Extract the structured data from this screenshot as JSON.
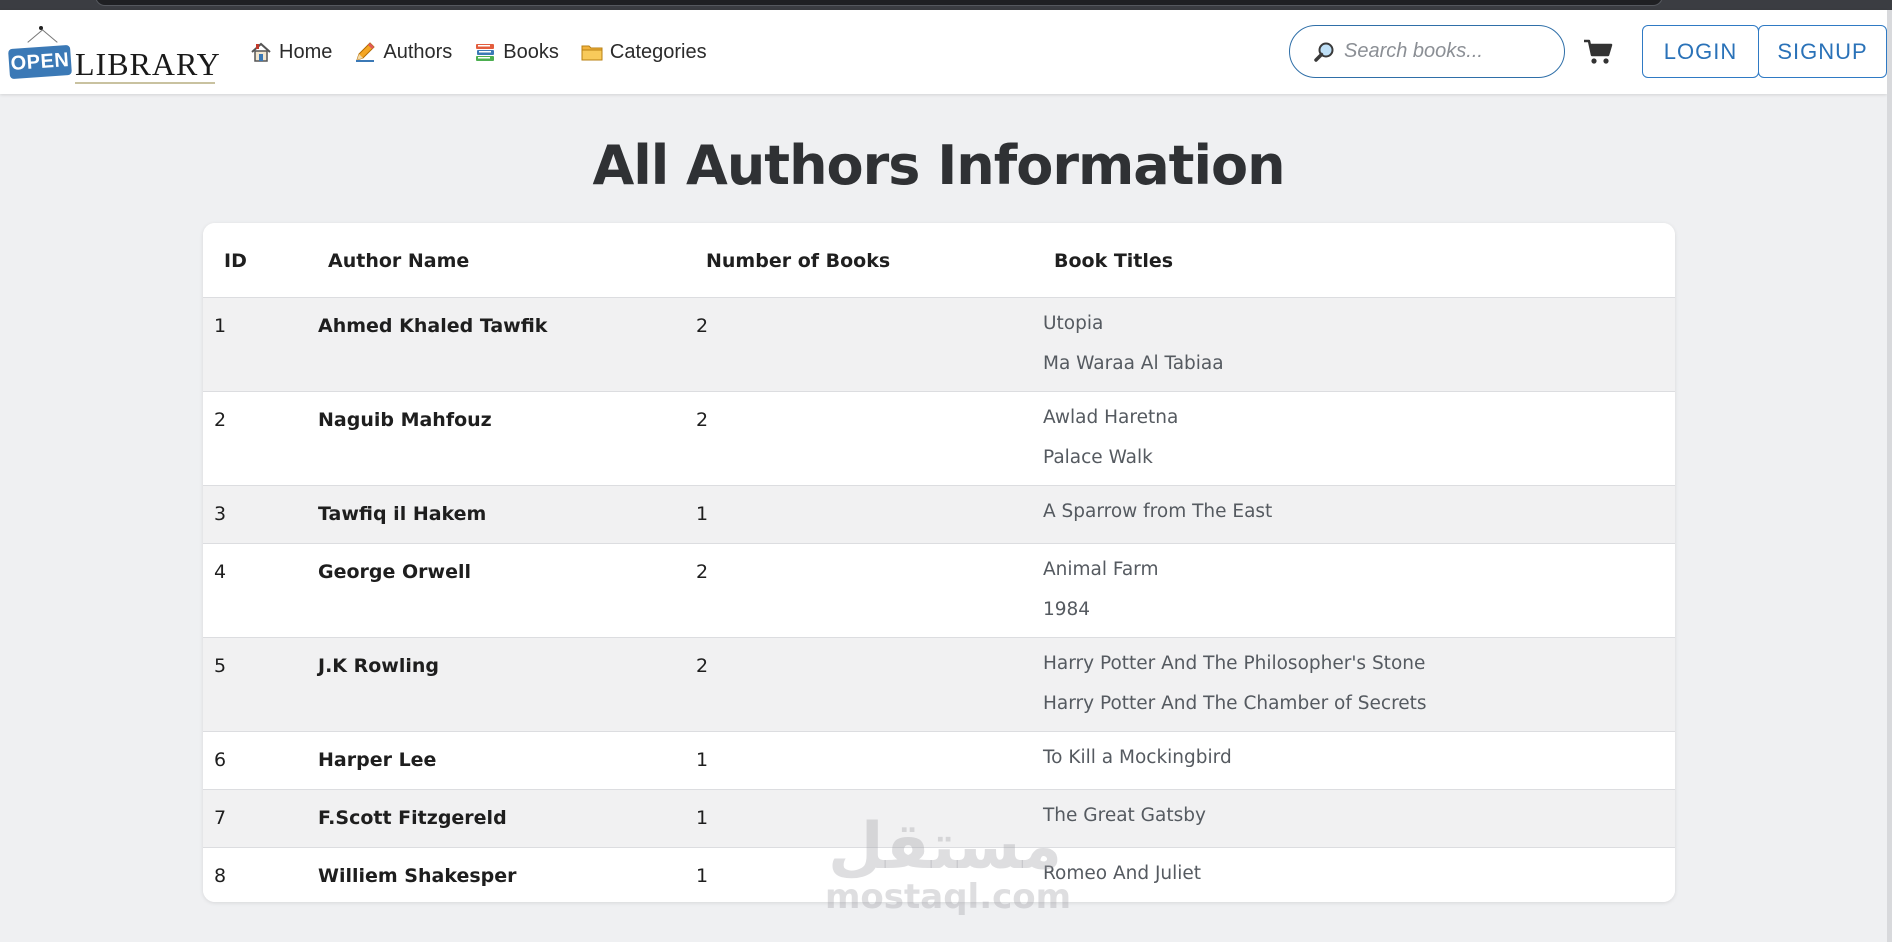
{
  "header": {
    "logo_open": "OPEN",
    "logo_library": "LIBRARY",
    "nav": [
      {
        "label": "Home",
        "icon": "home-icon"
      },
      {
        "label": "Authors",
        "icon": "pencil-icon"
      },
      {
        "label": "Books",
        "icon": "books-icon"
      },
      {
        "label": "Categories",
        "icon": "folder-icon"
      }
    ],
    "search_placeholder": "Search books...",
    "login_label": "LOGIN",
    "signup_label": "SIGNUP"
  },
  "page_title": "All Authors Information",
  "table": {
    "headers": [
      "ID",
      "Author Name",
      "Number of Books",
      "Book Titles"
    ],
    "rows": [
      {
        "id": "1",
        "name": "Ahmed Khaled Tawfik",
        "count": "2",
        "titles": [
          "Utopia",
          "Ma Waraa Al Tabiaa"
        ]
      },
      {
        "id": "2",
        "name": "Naguib Mahfouz",
        "count": "2",
        "titles": [
          "Awlad Haretna",
          "Palace Walk"
        ]
      },
      {
        "id": "3",
        "name": "Tawfiq il Hakem",
        "count": "1",
        "titles": [
          "A Sparrow from The East"
        ]
      },
      {
        "id": "4",
        "name": "George Orwell",
        "count": "2",
        "titles": [
          "Animal Farm",
          "1984"
        ]
      },
      {
        "id": "5",
        "name": "J.K Rowling",
        "count": "2",
        "titles": [
          "Harry Potter And The Philosopher's Stone",
          "Harry Potter And The Chamber of Secrets"
        ]
      },
      {
        "id": "6",
        "name": "Harper Lee",
        "count": "1",
        "titles": [
          "To Kill a Mockingbird"
        ]
      },
      {
        "id": "7",
        "name": "F.Scott Fitzgereld",
        "count": "1",
        "titles": [
          "The Great Gatsby"
        ]
      },
      {
        "id": "8",
        "name": "Williem Shakesper",
        "count": "1",
        "titles": [
          "Romeo And Juliet"
        ]
      }
    ]
  },
  "watermark": {
    "arabic": "مستقل",
    "latin": "mostaql.com"
  },
  "colors": {
    "accent": "#2a72b8",
    "page_bg": "#eff0f2",
    "row_alt": "#f1f1f2"
  }
}
